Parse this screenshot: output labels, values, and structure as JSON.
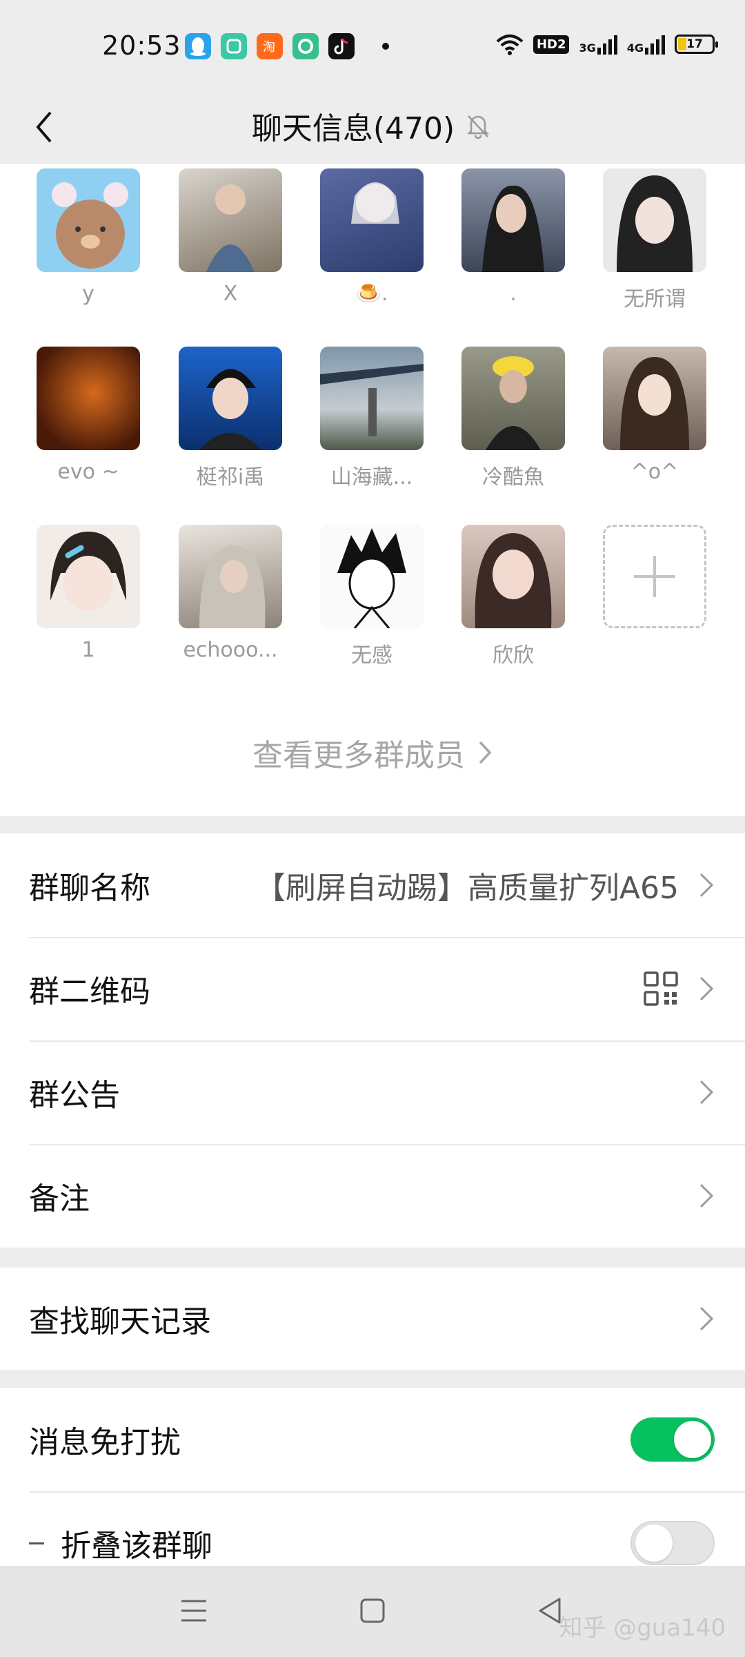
{
  "status_bar": {
    "time": "20:53",
    "hd_label": "HD2",
    "net_labels": [
      "3G",
      "4G"
    ],
    "battery": "17",
    "app_icons": [
      "qq-icon",
      "chat-app-icon",
      "taobao-icon",
      "camera-app-icon",
      "douyin-icon"
    ]
  },
  "header": {
    "title": "聊天信息(470)",
    "back_icon": "chevron-left-icon",
    "mute_icon": "bell-off-icon"
  },
  "members": [
    {
      "name": "y"
    },
    {
      "name": "X"
    },
    {
      "name": "🍮."
    },
    {
      "name": "."
    },
    {
      "name": "无所谓"
    },
    {
      "name": "evo ~"
    },
    {
      "name": "梃祁i禹"
    },
    {
      "name": "山海藏..."
    },
    {
      "name": "冷酷魚"
    },
    {
      "name": "^o^"
    },
    {
      "name": "1"
    },
    {
      "name": "echooo..."
    },
    {
      "name": "无感"
    },
    {
      "name": "欣欣"
    }
  ],
  "more_members_label": "查看更多群成员",
  "settings_group1": {
    "group_name_label": "群聊名称",
    "group_name_value": "【刷屏自动踢】高质量扩列A65",
    "qrcode_label": "群二维码",
    "announcement_label": "群公告",
    "remark_label": "备注"
  },
  "settings_group2": {
    "search_history_label": "查找聊天记录"
  },
  "settings_group3": {
    "mute_label": "消息免打扰",
    "mute_on": true,
    "fold_label": "折叠该群聊",
    "fold_on": false
  },
  "colors": {
    "accent_green": "#07c160",
    "background": "#ededed",
    "secondary_text": "#9a9a9a"
  },
  "watermark": "知乎 @gua140"
}
